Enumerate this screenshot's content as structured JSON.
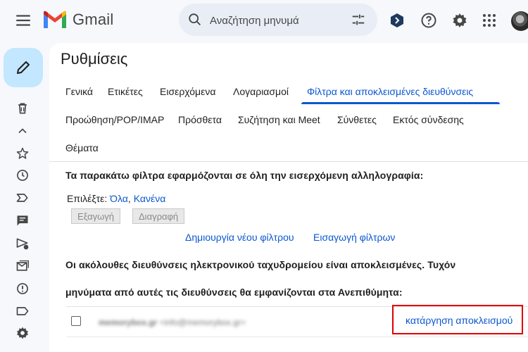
{
  "app": {
    "name": "Gmail"
  },
  "search": {
    "placeholder": "Αναζήτηση μηνυμά"
  },
  "settings": {
    "title": "Ρυθμίσεις",
    "tabs": [
      {
        "label": "Γενικά"
      },
      {
        "label": "Ετικέτες"
      },
      {
        "label": "Εισερχόμενα"
      },
      {
        "label": "Λογαριασμοί"
      },
      {
        "label": "Φίλτρα και αποκλεισμένες διευθύνσεις",
        "active": true
      },
      {
        "label": "Προώθηση/POP/IMAP"
      },
      {
        "label": "Πρόσθετα"
      },
      {
        "label": "Συζήτηση και Meet"
      },
      {
        "label": "Σύνθετες"
      },
      {
        "label": "Εκτός σύνδεσης"
      },
      {
        "label": "Θέματα"
      }
    ]
  },
  "filters": {
    "heading": "Τα παρακάτω φίλτρα εφαρμόζονται σε όλη την εισερχόμενη αλληλογραφία:",
    "select_label": "Επιλέξτε:",
    "select_all": "Όλα",
    "select_none": "Κανένα",
    "export_label": "Εξαγωγή",
    "delete_label": "Διαγραφή",
    "create_filter": "Δημιουργία νέου φίλτρου",
    "import_filters": "Εισαγωγή φίλτρων"
  },
  "blocked": {
    "heading_line1": "Οι ακόλουθες διευθύνσεις ηλεκτρονικού ταχυδρομείου είναι αποκλεισμένες. Τυχόν",
    "heading_line2": "μηνύματα από αυτές τις διευθύνσεις θα εμφανίζονται στα Ανεπιθύμητα:",
    "rows": [
      {
        "name": "memorybox.gr",
        "email": "<info@memorybox.gr>",
        "action": "κατάργηση αποκλεισμού"
      }
    ]
  },
  "colors": {
    "accent": "#0b57d0",
    "compose_bg": "#c2e7ff",
    "highlight_border": "#e00000"
  },
  "icons": [
    "menu-icon",
    "search-icon",
    "tune-icon",
    "gemini-icon",
    "help-icon",
    "settings-gear-icon",
    "apps-grid-icon",
    "pencil-icon",
    "trash-icon",
    "chevron-up-icon",
    "star-icon",
    "clock-icon",
    "important-icon",
    "chat-icon",
    "scheduled-send-icon",
    "all-mail-icon",
    "spam-icon",
    "label-icon",
    "manage-gear-icon"
  ]
}
